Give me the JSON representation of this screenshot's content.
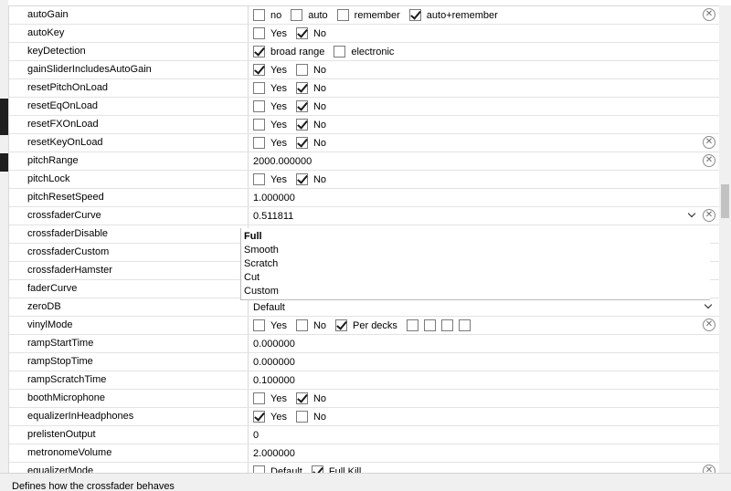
{
  "rows": [
    {
      "name": "autoGain",
      "type": "checks",
      "options": [
        {
          "label": "no",
          "checked": false
        },
        {
          "label": "auto",
          "checked": false
        },
        {
          "label": "remember",
          "checked": false
        },
        {
          "label": "auto+remember",
          "checked": true
        }
      ],
      "clear": true
    },
    {
      "name": "autoKey",
      "type": "checks",
      "options": [
        {
          "label": "Yes",
          "checked": false
        },
        {
          "label": "No",
          "checked": true
        }
      ]
    },
    {
      "name": "keyDetection",
      "type": "checks",
      "options": [
        {
          "label": "broad range",
          "checked": true
        },
        {
          "label": "electronic",
          "checked": false
        }
      ]
    },
    {
      "name": "gainSliderIncludesAutoGain",
      "type": "checks",
      "options": [
        {
          "label": "Yes",
          "checked": true
        },
        {
          "label": "No",
          "checked": false
        }
      ]
    },
    {
      "name": "resetPitchOnLoad",
      "type": "checks",
      "options": [
        {
          "label": "Yes",
          "checked": false
        },
        {
          "label": "No",
          "checked": true
        }
      ]
    },
    {
      "name": "resetEqOnLoad",
      "type": "checks",
      "options": [
        {
          "label": "Yes",
          "checked": false
        },
        {
          "label": "No",
          "checked": true
        }
      ]
    },
    {
      "name": "resetFXOnLoad",
      "type": "checks",
      "options": [
        {
          "label": "Yes",
          "checked": false
        },
        {
          "label": "No",
          "checked": true
        }
      ]
    },
    {
      "name": "resetKeyOnLoad",
      "type": "checks",
      "options": [
        {
          "label": "Yes",
          "checked": false
        },
        {
          "label": "No",
          "checked": true
        }
      ],
      "clear": true
    },
    {
      "name": "pitchRange",
      "type": "text",
      "value": "2000.000000",
      "clear": true
    },
    {
      "name": "pitchLock",
      "type": "checks",
      "options": [
        {
          "label": "Yes",
          "checked": false
        },
        {
          "label": "No",
          "checked": true
        }
      ]
    },
    {
      "name": "pitchResetSpeed",
      "type": "text",
      "value": "1.000000"
    },
    {
      "name": "crossfaderCurve",
      "type": "text",
      "value": "0.511811",
      "dropdown": true,
      "clear": true
    },
    {
      "name": "crossfaderDisable",
      "type": "dd"
    },
    {
      "name": "crossfaderCustom",
      "type": "dd"
    },
    {
      "name": "crossfaderHamster",
      "type": "dd"
    },
    {
      "name": "faderCurve",
      "type": "dd"
    },
    {
      "name": "zeroDB",
      "type": "text",
      "value": "Default",
      "dropdown": true
    },
    {
      "name": "vinylMode",
      "type": "checks",
      "options": [
        {
          "label": "Yes",
          "checked": false
        },
        {
          "label": "No",
          "checked": false
        },
        {
          "label": "Per decks",
          "checked": true
        },
        {
          "label": "",
          "checked": false
        },
        {
          "label": "",
          "checked": false
        },
        {
          "label": "",
          "checked": false
        },
        {
          "label": "",
          "checked": false
        }
      ],
      "clear": true
    },
    {
      "name": "rampStartTime",
      "type": "text",
      "value": "0.000000"
    },
    {
      "name": "rampStopTime",
      "type": "text",
      "value": "0.000000"
    },
    {
      "name": "rampScratchTime",
      "type": "text",
      "value": "0.100000"
    },
    {
      "name": "boothMicrophone",
      "type": "checks",
      "options": [
        {
          "label": "Yes",
          "checked": false
        },
        {
          "label": "No",
          "checked": true
        }
      ]
    },
    {
      "name": "equalizerInHeadphones",
      "type": "checks",
      "options": [
        {
          "label": "Yes",
          "checked": true
        },
        {
          "label": "No",
          "checked": false
        }
      ]
    },
    {
      "name": "prelistenOutput",
      "type": "text",
      "value": "0"
    },
    {
      "name": "metronomeVolume",
      "type": "text",
      "value": "2.000000"
    },
    {
      "name": "equalizerMode",
      "type": "checks",
      "options": [
        {
          "label": "Default",
          "checked": false
        },
        {
          "label": "Full Kill",
          "checked": true
        }
      ],
      "clear": true
    }
  ],
  "dropdown": {
    "options": [
      "Full",
      "Smooth",
      "Scratch",
      "Cut",
      "Custom"
    ],
    "selected": "Full"
  },
  "status": {
    "text": "Defines how the crossfader behaves"
  },
  "icons": {
    "clear": "clear-circle-icon",
    "chevron": "chevron-down-icon",
    "check": "checkmark-icon"
  }
}
